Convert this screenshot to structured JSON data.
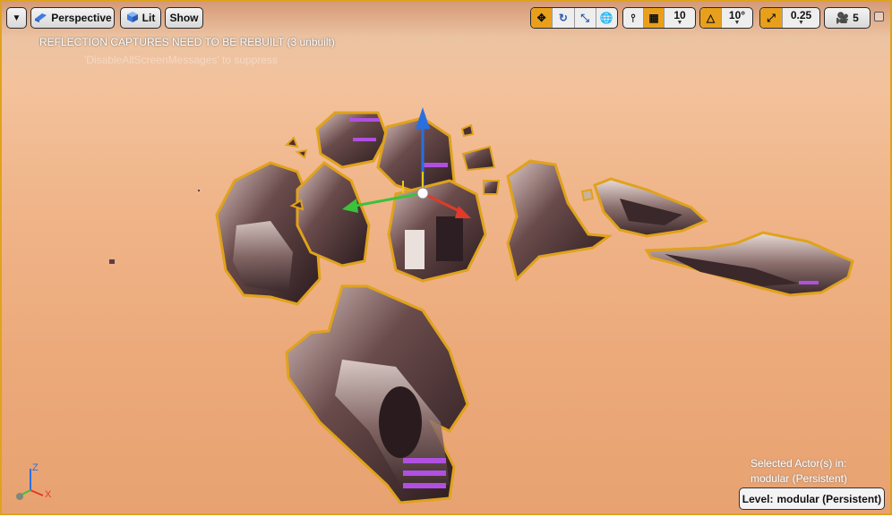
{
  "toolbar": {
    "perspective_label": "Perspective",
    "lit_label": "Lit",
    "show_label": "Show",
    "grid_snap_value": "10",
    "rotation_snap_value": "10°",
    "scale_snap_value": "0.25",
    "camera_speed_value": "5"
  },
  "messages": {
    "warning": "REFLECTION CAPTURES NEED TO BE REBUILT (3 unbuilt)",
    "suppress_hint": "'DisableAllScreenMessages' to suppress"
  },
  "selection_info": {
    "line1": "Selected Actor(s) in:",
    "line2": "modular (Persistent)"
  },
  "level": {
    "prefix": "Level:",
    "name": "modular (Persistent)"
  },
  "axis_labels": {
    "z": "Z",
    "x": "X"
  },
  "colors": {
    "accent": "#e8a01c",
    "selection_outline": "#e0a21c",
    "gizmo_z": "#2a6fe0",
    "gizmo_y": "#3cc23c",
    "gizmo_x": "#e03a2a",
    "emissive": "#b050e0"
  },
  "icons": [
    "dropdown-arrow-icon",
    "perspective-icon",
    "lit-cube-icon",
    "translate-icon",
    "rotate-icon",
    "scale-icon",
    "world-space-icon",
    "surface-snap-icon",
    "grid-icon",
    "angle-icon",
    "scale-snap-icon",
    "camera-speed-icon",
    "maximize-icon"
  ]
}
